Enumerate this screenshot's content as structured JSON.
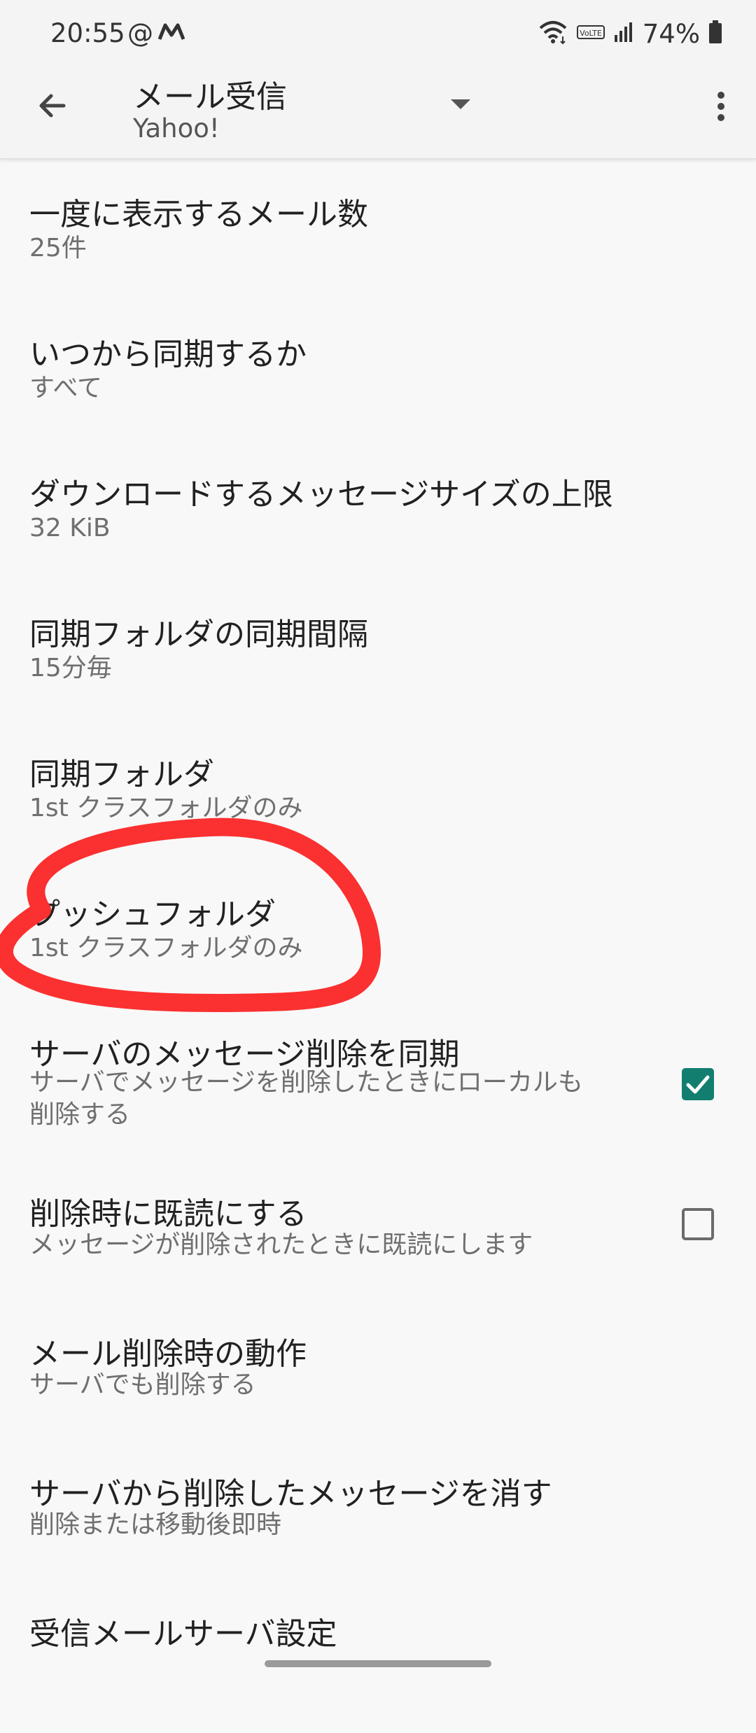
{
  "status_bar": {
    "time": "20:55",
    "at_symbol": "@",
    "notification_icon": "m-logo-icon",
    "volte_label": "VoLTE",
    "battery_text": "74%"
  },
  "app_bar": {
    "title": "メール受信",
    "subtitle": "Yahoo!",
    "back_icon": "arrow-back-icon",
    "dropdown_icon": "arrow-drop-down-icon",
    "overflow_icon": "more-vert-icon"
  },
  "settings": [
    {
      "title": "一度に表示するメール数",
      "summary": "25件"
    },
    {
      "title": "いつから同期するか",
      "summary": "すべて"
    },
    {
      "title": "ダウンロードするメッセージサイズの上限",
      "summary": "32 KiB"
    },
    {
      "title": "同期フォルダの同期間隔",
      "summary": "15分毎"
    },
    {
      "title": "同期フォルダ",
      "summary": "1st クラスフォルダのみ"
    },
    {
      "title": "プッシュフォルダ",
      "summary": "1st クラスフォルダのみ"
    },
    {
      "title": "サーバのメッセージ削除を同期",
      "summary_line1": "サーバでメッセージを削除したときにローカルも",
      "summary_line2": "削除する",
      "checked": true
    },
    {
      "title": "削除時に既読にする",
      "summary": "メッセージが削除されたときに既読にします",
      "checked": false
    },
    {
      "title": "メール削除時の動作",
      "summary": "サーバでも削除する"
    },
    {
      "title": "サーバから削除したメッセージを消す",
      "summary": "削除または移動後即時"
    },
    {
      "title": "受信メールサーバ設定"
    }
  ],
  "colors": {
    "accent": "#127e6f",
    "annotation": "#fb3030",
    "background": "#f8f8f8"
  }
}
